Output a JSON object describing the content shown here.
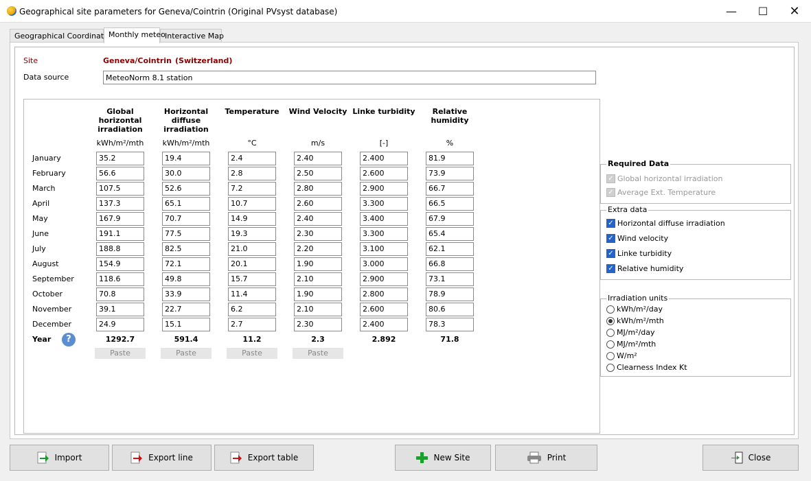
{
  "window": {
    "title": "Geographical site parameters for Geneva/Cointrin (Original PVsyst database)"
  },
  "tabs": [
    "Geographical Coordinates",
    "Monthly meteo",
    "Interactive Map"
  ],
  "site": {
    "label": "Site",
    "name": "Geneva/Cointrin",
    "country": "(Switzerland)"
  },
  "data_source": {
    "label": "Data source",
    "value": "MeteoNorm 8.1 station"
  },
  "columns": [
    {
      "header": "Global horizontal irradiation",
      "unit": "kWh/m²/mth"
    },
    {
      "header": "Horizontal diffuse irradiation",
      "unit": "kWh/m²/mth"
    },
    {
      "header": "Temperature",
      "unit": "°C"
    },
    {
      "header": "Wind Velocity",
      "unit": "m/s"
    },
    {
      "header": "Linke turbidity",
      "unit": "[-]"
    },
    {
      "header": "Relative humidity",
      "unit": "%"
    }
  ],
  "months": [
    "January",
    "February",
    "March",
    "April",
    "May",
    "June",
    "July",
    "August",
    "September",
    "October",
    "November",
    "December"
  ],
  "rows": [
    [
      "35.2",
      "19.4",
      "2.4",
      "2.40",
      "2.400",
      "81.9"
    ],
    [
      "56.6",
      "30.0",
      "2.8",
      "2.50",
      "2.600",
      "73.9"
    ],
    [
      "107.5",
      "52.6",
      "7.2",
      "2.80",
      "2.900",
      "66.7"
    ],
    [
      "137.3",
      "65.1",
      "10.7",
      "2.60",
      "3.300",
      "66.5"
    ],
    [
      "167.9",
      "70.7",
      "14.9",
      "2.40",
      "3.400",
      "67.9"
    ],
    [
      "191.1",
      "77.5",
      "19.3",
      "2.30",
      "3.300",
      "65.4"
    ],
    [
      "188.8",
      "82.5",
      "21.0",
      "2.20",
      "3.100",
      "62.1"
    ],
    [
      "154.9",
      "72.1",
      "20.1",
      "1.90",
      "3.000",
      "66.8"
    ],
    [
      "118.6",
      "49.8",
      "15.7",
      "2.10",
      "2.900",
      "73.1"
    ],
    [
      "70.8",
      "33.9",
      "11.4",
      "1.90",
      "2.800",
      "78.9"
    ],
    [
      "39.1",
      "22.7",
      "6.2",
      "2.10",
      "2.600",
      "80.6"
    ],
    [
      "24.9",
      "15.1",
      "2.7",
      "2.30",
      "2.400",
      "78.3"
    ]
  ],
  "year": {
    "label": "Year",
    "values": [
      "1292.7",
      "591.4",
      "11.2",
      "2.3",
      "2.892",
      "71.8"
    ]
  },
  "paste_label": "Paste",
  "required_data": {
    "title": "Required Data",
    "items": [
      "Global horizontal irradiation",
      "Average Ext. Temperature"
    ]
  },
  "extra_data": {
    "title": "Extra data",
    "items": [
      "Horizontal diffuse irradiation",
      "Wind velocity",
      "Linke turbidity",
      "Relative humidity"
    ]
  },
  "irradiation_units": {
    "title": "Irradiation units",
    "options": [
      "kWh/m²/day",
      "kWh/m²/mth",
      "MJ/m²/day",
      "MJ/m²/mth",
      "W/m²",
      "Clearness Index Kt"
    ],
    "selected": 1
  },
  "buttons": {
    "import": "Import",
    "export_line": "Export line",
    "export_table": "Export table",
    "new_site": "New Site",
    "print": "Print",
    "close": "Close"
  }
}
